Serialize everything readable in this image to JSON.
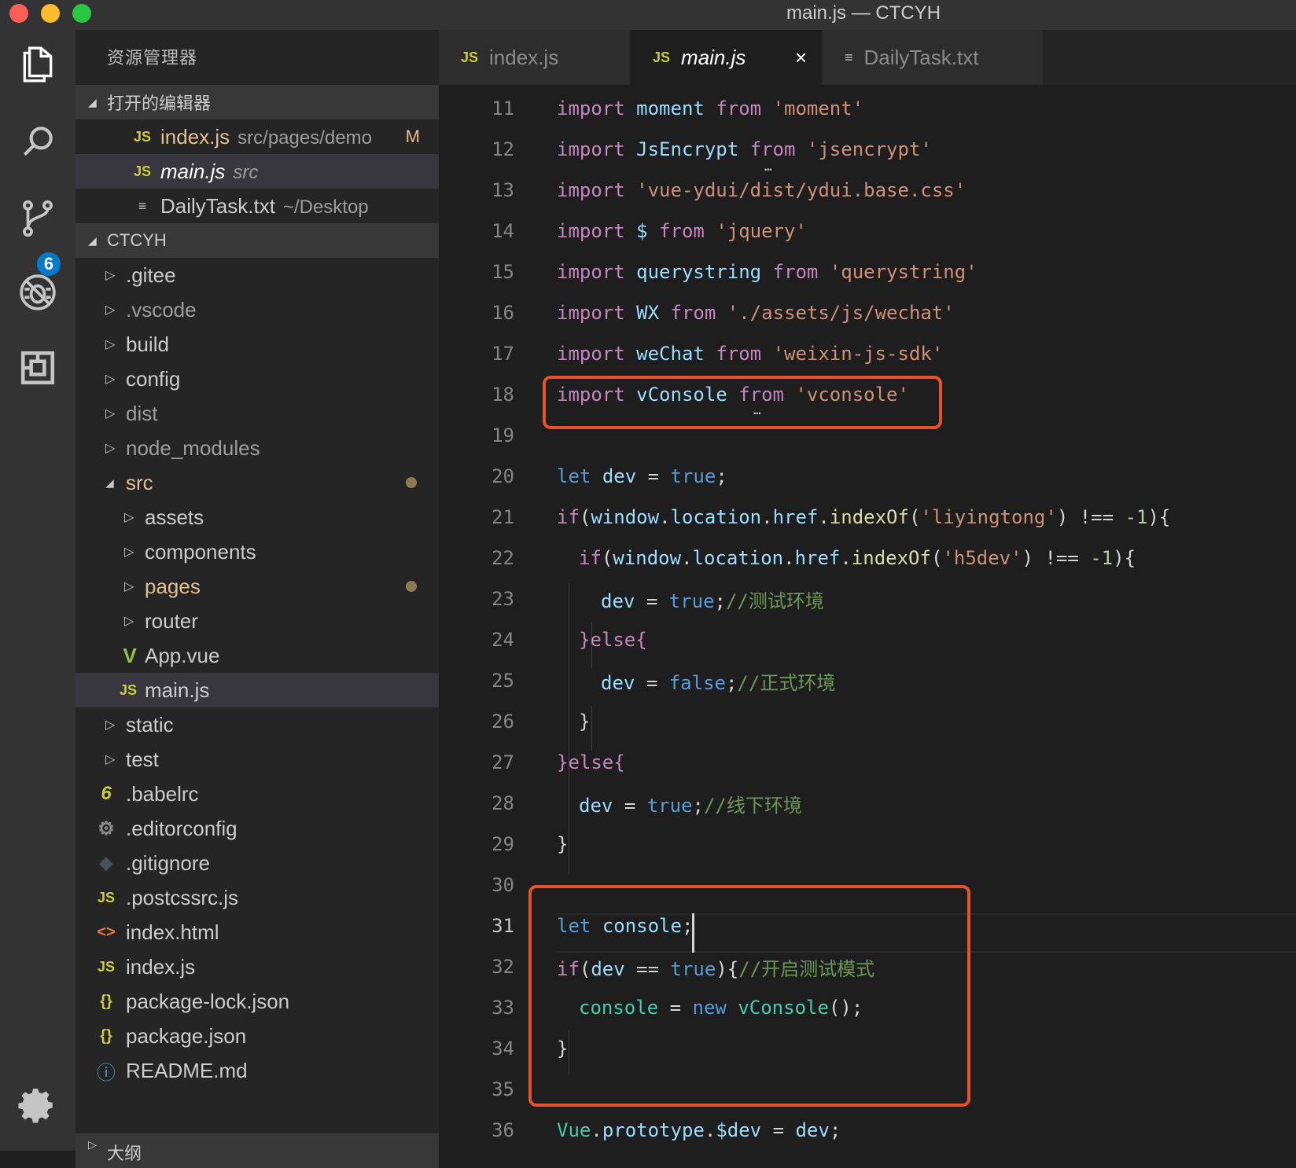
{
  "window": {
    "title": "main.js — CTCYH"
  },
  "activity_bar": {
    "items": [
      {
        "icon": "files-icon"
      },
      {
        "icon": "search-icon"
      },
      {
        "icon": "source-control-icon"
      },
      {
        "icon": "debug-icon"
      },
      {
        "icon": "extensions-icon"
      },
      {
        "icon": "gear-icon"
      }
    ],
    "scm_badge": "6"
  },
  "sidebar": {
    "title": "资源管理器",
    "open_editors": {
      "label": "打开的编辑器",
      "items": [
        {
          "icon": "JS",
          "name": "index.js",
          "desc": "src/pages/demo",
          "mark": "M"
        },
        {
          "icon": "JS",
          "name": "main.js",
          "desc": "src"
        },
        {
          "icon": "≡",
          "name": "DailyTask.txt",
          "desc": "~/Desktop"
        }
      ]
    },
    "project": {
      "label": "CTCYH",
      "items": [
        {
          "name": ".gitee"
        },
        {
          "name": ".vscode"
        },
        {
          "name": "build"
        },
        {
          "name": "config"
        },
        {
          "name": "dist"
        },
        {
          "name": "node_modules"
        },
        {
          "name": "src"
        },
        {
          "name": "assets"
        },
        {
          "name": "components"
        },
        {
          "name": "pages"
        },
        {
          "name": "router"
        },
        {
          "name": "App.vue",
          "icon": "V"
        },
        {
          "name": "main.js",
          "icon": "JS"
        },
        {
          "name": "static"
        },
        {
          "name": "test"
        },
        {
          "name": ".babelrc",
          "icon": "6"
        },
        {
          "name": ".editorconfig",
          "icon": "⚙"
        },
        {
          "name": ".gitignore",
          "icon": "◆"
        },
        {
          "name": ".postcssrc.js",
          "icon": "JS"
        },
        {
          "name": "index.html",
          "icon": "<>"
        },
        {
          "name": "index.js",
          "icon": "JS"
        },
        {
          "name": "package-lock.json",
          "icon": "{}"
        },
        {
          "name": "package.json",
          "icon": "{}"
        },
        {
          "name": "README.md",
          "icon": "ⓘ"
        }
      ]
    },
    "outline_label": "大纲"
  },
  "tabs": [
    {
      "icon": "JS",
      "label": "index.js"
    },
    {
      "icon": "JS",
      "label": "main.js",
      "close": "×"
    },
    {
      "icon": "≡",
      "label": "DailyTask.txt"
    }
  ],
  "editor": {
    "line_numbers": [
      "11",
      "12",
      "13",
      "14",
      "15",
      "16",
      "17",
      "18",
      "19",
      "20",
      "21",
      "22",
      "23",
      "24",
      "25",
      "26",
      "27",
      "28",
      "29",
      "30",
      "31",
      "32",
      "33",
      "34",
      "35",
      "36"
    ],
    "lines": {
      "l11": [
        "import",
        "moment",
        "from",
        "'moment'"
      ],
      "l12": [
        "import",
        "JsEncrypt",
        "from",
        "'jsencrypt'"
      ],
      "l13": [
        "import",
        "'vue-ydui/dist/ydui.base.css'"
      ],
      "l14": [
        "import",
        "$",
        "from",
        "'jquery'"
      ],
      "l15": [
        "import",
        "querystring",
        "from",
        "'querystring'"
      ],
      "l16": [
        "import",
        "WX",
        "from",
        "'./assets/js/wechat'"
      ],
      "l17": [
        "import",
        "weChat",
        "from",
        "'weixin-js-sdk'"
      ],
      "l18": [
        "import",
        "vConsole",
        "from",
        "'vconsole'"
      ],
      "l20": [
        "let",
        "dev",
        "=",
        "true",
        ";"
      ],
      "l21": [
        "if",
        "(",
        "window",
        ".",
        "location",
        ".",
        "href",
        ".",
        "indexOf",
        "(",
        "'liyingtong'",
        ")",
        "!==",
        "-1",
        "){"
      ],
      "l22": [
        "if",
        "(",
        "window",
        ".",
        "location",
        ".",
        "href",
        ".",
        "indexOf",
        "(",
        "'h5dev'",
        ")",
        "!==",
        "-1",
        "){"
      ],
      "l23": [
        "dev",
        "=",
        "true",
        ";",
        "//测试环境"
      ],
      "l24": [
        "}else{"
      ],
      "l25": [
        "dev",
        "=",
        "false",
        ";",
        "//正式环境"
      ],
      "l26": [
        "}"
      ],
      "l27": [
        "}else{"
      ],
      "l28": [
        "dev",
        "=",
        "true",
        ";",
        "//线下环境"
      ],
      "l29": [
        "}"
      ],
      "l31": [
        "let",
        "console",
        ";"
      ],
      "l32": [
        "if",
        "(",
        "dev",
        "==",
        "true",
        "){",
        "//开启测试模式"
      ],
      "l33": [
        "console",
        "=",
        "new",
        "vConsole",
        "();"
      ],
      "l34": [
        "}"
      ],
      "l36": [
        "Vue",
        ".",
        "prototype",
        ".",
        "$dev",
        "=",
        "dev",
        ";"
      ]
    },
    "hint_dots": "…",
    "current_line": "31"
  },
  "colors": {
    "highlight_box": "#e8522a",
    "keyword": "#c586c0",
    "string": "#ce9178",
    "variable": "#9cdcfe",
    "constant": "#569cd6",
    "comment": "#6a9955"
  }
}
